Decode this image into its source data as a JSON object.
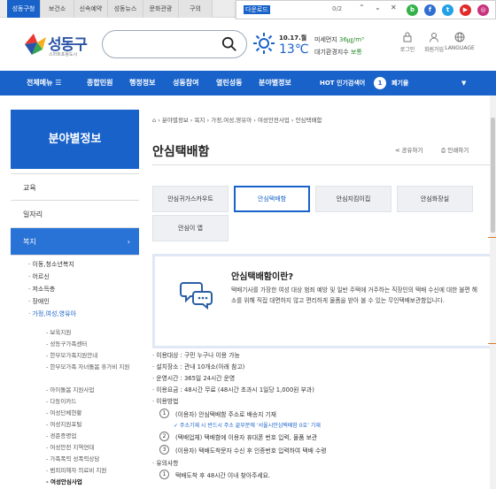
{
  "topbar": {
    "tabs": [
      "성동구청",
      "보건소",
      "신속예약",
      "성동뉴스",
      "문화관광",
      "구의"
    ],
    "active_tab": "성동구청"
  },
  "findbar": {
    "query": "다운로드",
    "count": "0/2"
  },
  "sns": [
    {
      "name": "blog-icon",
      "glyph": "b",
      "color": "#33b24a"
    },
    {
      "name": "facebook-icon",
      "glyph": "f",
      "color": "#2f6fd1"
    },
    {
      "name": "twitter-icon",
      "glyph": "t",
      "color": "#22a1e8"
    },
    {
      "name": "youtube-icon",
      "glyph": "▶",
      "color": "#e22a2a"
    },
    {
      "name": "instagram-icon",
      "glyph": "◎",
      "color": "#c9337e"
    }
  ],
  "header": {
    "logo_name": "성동구",
    "logo_sub": "스마트포용도시",
    "search_placeholder": "",
    "date": "10.17.월",
    "temp": "13℃",
    "dust1_label": "미세먼지",
    "dust1_value": "36㎍/m³",
    "dust2_label": "대기환경지수",
    "dust2_value": "보통",
    "util": [
      "로그인",
      "회원가입",
      "LANGUAGE"
    ]
  },
  "nav": {
    "all_menu": "전체메뉴",
    "items": [
      "종합민원",
      "행정정보",
      "성동참여",
      "열린성동",
      "분야별정보"
    ],
    "hot_label": "HOT 인기검색어",
    "hot_rank": "1",
    "hot_word": "폐기물"
  },
  "sidebar": {
    "title": "분야별정보",
    "menus": [
      "교육",
      "일자리",
      "복지"
    ],
    "sub1": [
      "이동,청소년복지",
      "어르신",
      "저소득층",
      "장애인",
      "가정,여성,영유아"
    ],
    "sub2": [
      "보육지원",
      "성동구가족센터",
      "한부모가족지원안내",
      "한부모가족 자녀돌봄 휴가비 지원",
      "아이돌봄 지원사업",
      "다둥이카드",
      "여성단체현황",
      "여성지원포털",
      "경준증명업",
      "여성안전 지역연대",
      "가족폭력 성폭력상담",
      "범죄피해자 의료비 지원",
      "여성안심사업"
    ]
  },
  "main": {
    "crumbs": [
      "분야별정보",
      "복지",
      "가정,여성,영유아",
      "여성안전사업",
      "안심택배함"
    ],
    "title": "안심택배함",
    "share": "공유하기",
    "print": "인쇄하기",
    "tabs": [
      "안심귀가스카우트",
      "안심택배함",
      "안심지킴이집",
      "안심화장실",
      "안심이 앱"
    ],
    "active_tab": "안심택배함",
    "info_title": "안심택배함이란?",
    "info_text": "택배기사를 가장한 여성 대상 범죄 예방 및 일반 주택에 거주하는 직장인의 택배 수신에 대한 불편 해소를 위해 직접 대면하지 않고 편리하게 물품을 받아 볼 수 있는 무인택배보관함입니다.",
    "rules": [
      "이용대상 : 구민 누구나 이용 가능",
      "설치장소 : 관내 10개소(아래 참고)",
      "운영시간 : 365일 24시간 운영",
      "이용요금 : 48시간 무료 (48시간 초과시 1일당 1,000원 부과)",
      "이용방법"
    ],
    "steps": [
      "(이용자) 안심택배함 주소로 배송지 기재",
      "(택배업체) 택배함에 이용자 휴대폰 번호 입력, 물품 보관",
      "(이용자) 택배도착문자 수신 후 인증번호 입력하여 택배 수령"
    ],
    "step_note": "주소기재 시 반드시 주소 끝부분에 ‘서울시안심택배함 0호’ 기재",
    "caution": "유의사항",
    "caution_item": "택배도착 후 48시간 이내 찾아주세요."
  }
}
